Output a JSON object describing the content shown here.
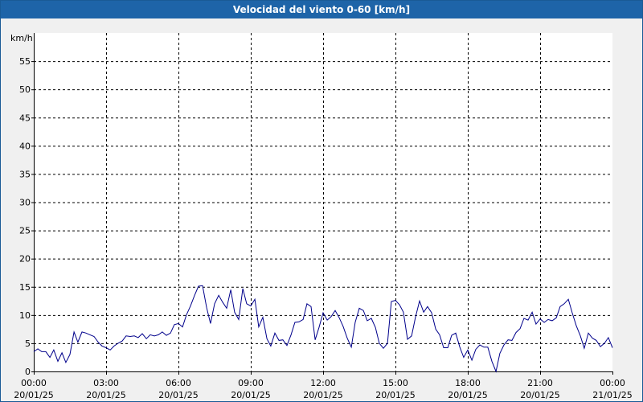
{
  "window": {
    "title": "Velocidad del viento 0-60 [km/h]"
  },
  "chart_data": {
    "type": "line",
    "title": "Velocidad del viento 0-60 [km/h]",
    "ylabel": "km/h",
    "xlabel": "",
    "ylim": [
      0,
      60
    ],
    "yticks": [
      0,
      5,
      10,
      15,
      20,
      25,
      30,
      35,
      40,
      45,
      50,
      55
    ],
    "xlim_hours": [
      0,
      24
    ],
    "xtick_labels": [
      {
        "time": "00:00",
        "date": "20/01/25"
      },
      {
        "time": "03:00",
        "date": "20/01/25"
      },
      {
        "time": "06:00",
        "date": "20/01/25"
      },
      {
        "time": "09:00",
        "date": "20/01/25"
      },
      {
        "time": "12:00",
        "date": "20/01/25"
      },
      {
        "time": "15:00",
        "date": "20/01/25"
      },
      {
        "time": "18:00",
        "date": "20/01/25"
      },
      {
        "time": "21:00",
        "date": "20/01/25"
      },
      {
        "time": "00:00",
        "date": "21/01/25"
      }
    ],
    "grid": true,
    "line_color": "#00008b",
    "series": [
      {
        "x_hours": [
          0.0,
          0.17,
          0.33,
          0.5,
          0.67,
          0.83,
          1.0,
          1.17,
          1.33,
          1.5,
          1.67,
          1.83,
          2.0,
          2.17,
          2.33,
          2.5,
          2.67,
          2.83,
          3.0,
          3.17,
          3.33,
          3.5,
          3.67,
          3.83,
          4.0,
          4.17,
          4.33,
          4.5,
          4.67,
          4.83,
          5.0,
          5.17,
          5.33,
          5.5,
          5.67,
          5.83,
          6.0,
          6.17,
          6.33,
          6.5,
          6.67,
          6.83,
          7.0,
          7.17,
          7.33,
          7.5,
          7.67,
          7.83,
          8.0,
          8.17,
          8.33,
          8.5,
          8.67,
          8.83,
          9.0,
          9.17,
          9.33,
          9.5,
          9.67,
          9.83,
          10.0,
          10.17,
          10.33,
          10.5,
          10.67,
          10.83,
          11.0,
          11.17,
          11.33,
          11.5,
          11.67,
          11.83,
          12.0,
          12.17,
          12.33,
          12.5,
          12.67,
          12.83,
          13.0,
          13.17,
          13.33,
          13.5,
          13.67,
          13.83,
          14.0,
          14.17,
          14.33,
          14.5,
          14.67,
          14.83,
          15.0,
          15.17,
          15.33,
          15.5,
          15.67,
          15.83,
          16.0,
          16.17,
          16.33,
          16.5,
          16.67,
          16.83,
          17.0,
          17.17,
          17.33,
          17.5,
          17.67,
          17.83,
          18.0,
          18.17,
          18.33,
          18.5,
          18.67,
          18.83,
          19.0,
          19.17,
          19.33,
          19.5,
          19.67,
          19.83,
          20.0,
          20.17,
          20.33,
          20.5,
          20.67,
          20.83,
          21.0,
          21.17,
          21.33,
          21.5,
          21.67,
          21.83,
          22.0,
          22.17,
          22.33,
          22.5,
          22.67,
          22.83,
          23.0,
          23.17,
          23.33,
          23.5,
          23.67,
          23.83,
          24.0
        ],
        "values": [
          3.5,
          4.0,
          3.5,
          3.5,
          2.5,
          3.8,
          1.8,
          3.3,
          1.6,
          3.0,
          7.0,
          5.2,
          7.0,
          6.8,
          6.5,
          6.2,
          5.2,
          4.5,
          4.2,
          3.8,
          4.5,
          5.0,
          5.4,
          6.3,
          6.2,
          6.3,
          6.0,
          6.7,
          5.8,
          6.5,
          6.3,
          6.5,
          7.0,
          6.4,
          6.8,
          8.3,
          8.5,
          7.9,
          10.0,
          11.6,
          13.5,
          15.1,
          15.2,
          11.3,
          8.5,
          12.0,
          13.5,
          12.3,
          11.2,
          14.5,
          10.5,
          9.2,
          14.7,
          12.0,
          11.6,
          12.8,
          7.9,
          9.6,
          5.8,
          4.5,
          6.8,
          5.5,
          5.6,
          4.6,
          6.5,
          8.7,
          8.8,
          9.2,
          12.0,
          11.5,
          5.6,
          7.8,
          10.4,
          9.1,
          9.7,
          10.8,
          9.5,
          8.0,
          5.9,
          4.3,
          8.7,
          11.2,
          10.8,
          9.0,
          9.4,
          7.8,
          5.0,
          4.1,
          5.0,
          12.4,
          12.6,
          11.8,
          10.5,
          5.7,
          6.3,
          9.6,
          12.5,
          10.5,
          11.5,
          10.4,
          7.5,
          6.5,
          4.2,
          4.2,
          6.4,
          6.8,
          4.3,
          2.5,
          3.8,
          2.0,
          3.9,
          4.7,
          4.3,
          4.3,
          1.8,
          0.0,
          3.2,
          4.7,
          5.6,
          5.5,
          6.9,
          7.6,
          9.4,
          9.1,
          10.5,
          8.4,
          9.3,
          8.7,
          9.2,
          9.0,
          9.5,
          11.5,
          12.0,
          12.8,
          10.4,
          8.1,
          6.3,
          4.1,
          6.8,
          5.9,
          5.5,
          4.4,
          5.0,
          6.0,
          4.2
        ]
      }
    ]
  }
}
